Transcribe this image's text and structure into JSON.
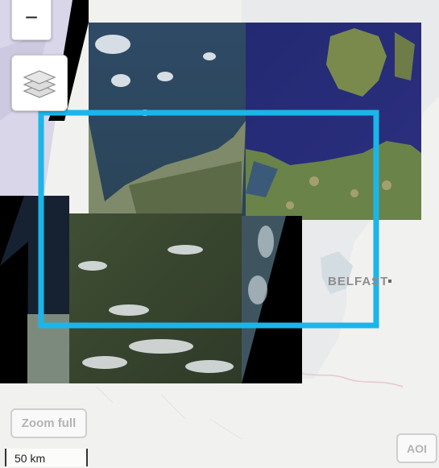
{
  "map": {
    "city_label": "BELFAST",
    "scale_label": "50 km",
    "colors": {
      "aoi_outline": "#1ab6ea",
      "land": "#f2f2f0",
      "water": "#cfd9df",
      "cloud_haze": "#d8d6e6"
    }
  },
  "controls": {
    "zoom_out_label": "−",
    "layers_icon": "layers-stack-icon",
    "zoom_full_label": "Zoom full",
    "aoi_label": "AOI"
  }
}
